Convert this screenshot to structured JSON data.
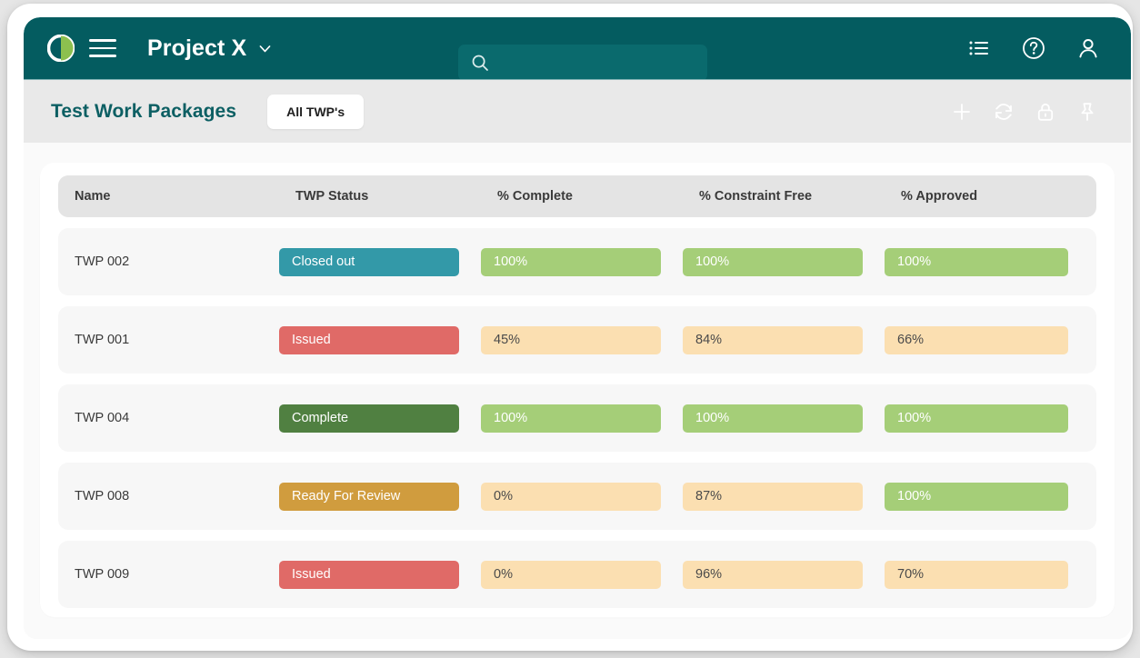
{
  "navbar": {
    "logo_name": "company-logo",
    "menu_label": "menu-icon",
    "project_name": "Project X",
    "chevron": "chevron-down-icon",
    "search": {
      "value": "",
      "placeholder": "",
      "icon": "search-icon"
    },
    "actions": [
      {
        "name": "list-view-icon",
        "label": "List"
      },
      {
        "name": "help-icon",
        "label": "Help"
      },
      {
        "name": "user-account-icon",
        "label": "Account"
      }
    ]
  },
  "subbar": {
    "title": "Test Work Packages",
    "tab_label": "All TWP's",
    "actions": [
      {
        "name": "add-icon",
        "label": "Add"
      },
      {
        "name": "refresh-icon",
        "label": "Refresh"
      },
      {
        "name": "lock-icon",
        "label": "Lock"
      },
      {
        "name": "pin-icon",
        "label": "Pin"
      }
    ]
  },
  "table": {
    "columns": [
      "Name",
      "TWP Status",
      "% Complete",
      "% Constraint Free",
      "% Approved"
    ],
    "rows": [
      {
        "name": "TWP 002",
        "status": {
          "label": "Closed out",
          "color": "#3399a8"
        },
        "complete": {
          "value": "100%",
          "tone": "green"
        },
        "constraint_free": {
          "value": "100%",
          "tone": "green"
        },
        "approved": {
          "value": "100%",
          "tone": "green"
        }
      },
      {
        "name": "TWP 001",
        "status": {
          "label": "Issued",
          "color": "#e06a67"
        },
        "complete": {
          "value": "45%",
          "tone": "amber"
        },
        "constraint_free": {
          "value": "84%",
          "tone": "amber"
        },
        "approved": {
          "value": "66%",
          "tone": "amber"
        }
      },
      {
        "name": "TWP 004",
        "status": {
          "label": "Complete",
          "color": "#508041"
        },
        "complete": {
          "value": "100%",
          "tone": "green"
        },
        "constraint_free": {
          "value": "100%",
          "tone": "green"
        },
        "approved": {
          "value": "100%",
          "tone": "green"
        }
      },
      {
        "name": "TWP 008",
        "status": {
          "label": "Ready For Review",
          "color": "#d09c3e"
        },
        "complete": {
          "value": "0%",
          "tone": "amber"
        },
        "constraint_free": {
          "value": "87%",
          "tone": "amber"
        },
        "approved": {
          "value": "100%",
          "tone": "green"
        }
      },
      {
        "name": "TWP 009",
        "status": {
          "label": "Issued",
          "color": "#e06a67"
        },
        "complete": {
          "value": "0%",
          "tone": "amber"
        },
        "constraint_free": {
          "value": "96%",
          "tone": "amber"
        },
        "approved": {
          "value": "70%",
          "tone": "amber"
        }
      }
    ]
  },
  "theme": {
    "nav_bg": "#045c60",
    "subbar_bg": "#e9e9e9",
    "title_color": "#0c5f63",
    "green": "#a5ce78",
    "amber": "#fbdfb1",
    "logo_green": "#8cc04f"
  }
}
